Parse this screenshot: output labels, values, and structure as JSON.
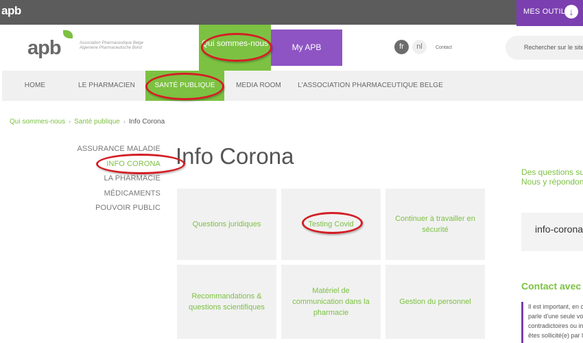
{
  "topbar": {
    "mini_logo": "apb",
    "tools_label": "MES OUTILS",
    "tools_icon": "download-arrow-icon"
  },
  "header": {
    "logo_text": "apb",
    "assoc_line1": "Association Pharmaceutique Belge",
    "assoc_line2": "Algemene Pharmaceutische Bond",
    "qui_label": "Qui sommes-nous",
    "myapb_label": "My APB",
    "lang_fr": "fr",
    "lang_nl": "nl",
    "contact": "Contact",
    "search_placeholder": "Rechercher sur le site"
  },
  "nav": {
    "items": [
      {
        "label": "HOME"
      },
      {
        "label": "LE PHARMACIEN"
      },
      {
        "label": "SANTÉ PUBLIQUE"
      },
      {
        "label": "MEDIA ROOM"
      },
      {
        "label": "L'ASSOCIATION PHARMACEUTIQUE BELGE"
      }
    ]
  },
  "breadcrumb": {
    "items": [
      "Qui sommes-nous",
      "Santé publique",
      "Info Corona"
    ]
  },
  "sidebar": {
    "items": [
      {
        "label": "ASSURANCE MALADIE"
      },
      {
        "label": "INFO CORONA"
      },
      {
        "label": "LA PHARMACIE"
      },
      {
        "label": "MÉDICAMENTS"
      },
      {
        "label": "POUVOIR PUBLIC"
      }
    ]
  },
  "main": {
    "title": "Info Corona",
    "tiles": [
      {
        "label": "Questions juridiques"
      },
      {
        "label": "Testing Covid"
      },
      {
        "label": "Continuer à travailler en sécurité"
      },
      {
        "label": "Recommandations & questions scientifiques"
      },
      {
        "label": "Matériel de communication dans la pharmacie"
      },
      {
        "label": "Gestion du personnel"
      }
    ]
  },
  "right": {
    "question_line1": "Des questions sur",
    "question_line2": "Nous y répondons",
    "box_text": "info-corona",
    "contact_heading": "Contact avec",
    "text_lines": [
      "Il est important, en c",
      "parle d'une seule vo",
      "contradictoires ou in",
      "êtes sollicité(e) par l"
    ]
  },
  "colors": {
    "green": "#7cc142",
    "purple": "#7b3fb0",
    "annotation_red": "#d31f25"
  }
}
